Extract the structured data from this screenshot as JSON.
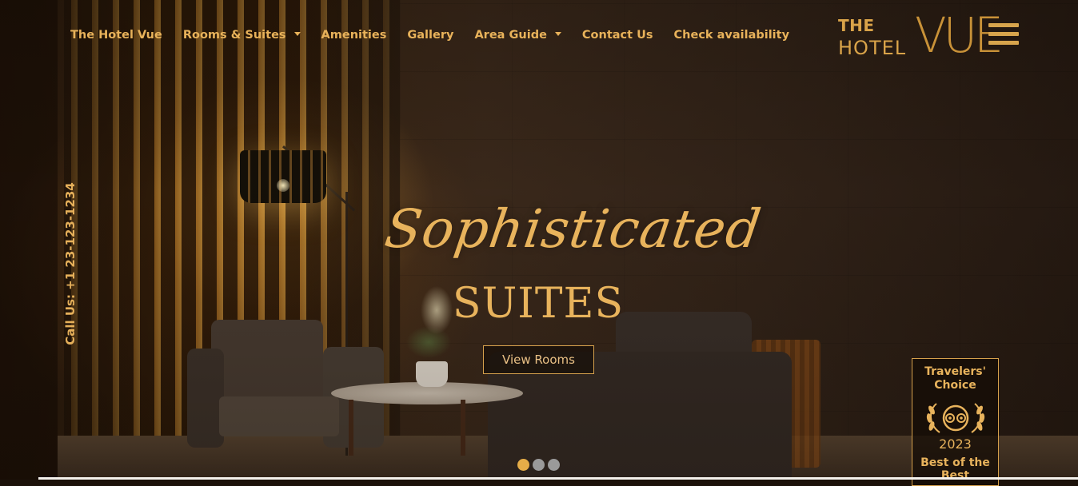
{
  "nav": {
    "items": [
      {
        "label": "The Hotel Vue",
        "has_dropdown": false
      },
      {
        "label": "Rooms & Suites",
        "has_dropdown": true
      },
      {
        "label": "Amenities",
        "has_dropdown": false
      },
      {
        "label": "Gallery",
        "has_dropdown": false
      },
      {
        "label": "Area Guide",
        "has_dropdown": true
      },
      {
        "label": "Contact Us",
        "has_dropdown": false
      },
      {
        "label": "Check availability",
        "has_dropdown": false
      }
    ]
  },
  "logo": {
    "the": "THE",
    "hotel": "HOTEL",
    "vue": "VUE"
  },
  "menu_icon": "hamburger-menu-icon",
  "call_us": "Call Us: +1 23-123-1234",
  "hero": {
    "script_title": "Sophisticated",
    "main_title": "SUITES",
    "cta": "View Rooms"
  },
  "carousel": {
    "slide_count": 3,
    "active_index": 0
  },
  "badge": {
    "title": "Travelers' Choice",
    "year": "2023",
    "subtitle": "Best of the Best",
    "icon": "tripadvisor-owl-laurel-icon"
  },
  "colors": {
    "accent": "#e8b35c",
    "dot_active": "#e6ad48",
    "dot_inactive": "#9a9a9a"
  }
}
